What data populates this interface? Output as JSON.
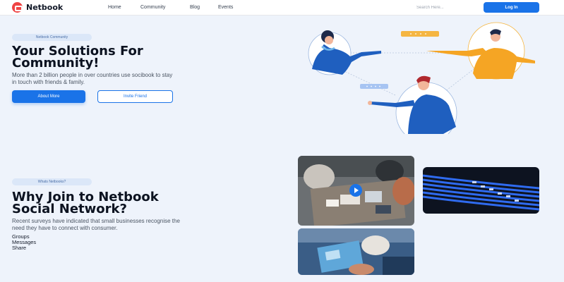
{
  "header": {
    "brand": "Netbook",
    "nav": [
      "Home",
      "Community",
      "Blog",
      "Events"
    ],
    "search_placeholder": "Search Here...",
    "login_label": "Log In"
  },
  "hero": {
    "pill": "Netbook Community",
    "title_line1": "Your Solutions For",
    "title_line2": "Community!",
    "desc_line1": "More than 2 billion people in over countries use socibook to stay",
    "desc_line2": "in touch with friends & family.",
    "primary_button": "About More",
    "secondary_button": "Invite Friend"
  },
  "why": {
    "pill": "Whats Netbooks?",
    "title_line1": "Why Join to Netbook",
    "title_line2": "Social Network?",
    "desc_line1": "Recent surveys have indicated that small businesses recognise the",
    "desc_line2": "need they have to connect with consumer.",
    "features": [
      "Groups",
      "Messages",
      "Share"
    ]
  },
  "colors": {
    "accent": "#1a73e8",
    "background": "#eef3fb",
    "chat_bubble": "#f5b642",
    "chat_bubble_2": "#a7c4f2"
  }
}
